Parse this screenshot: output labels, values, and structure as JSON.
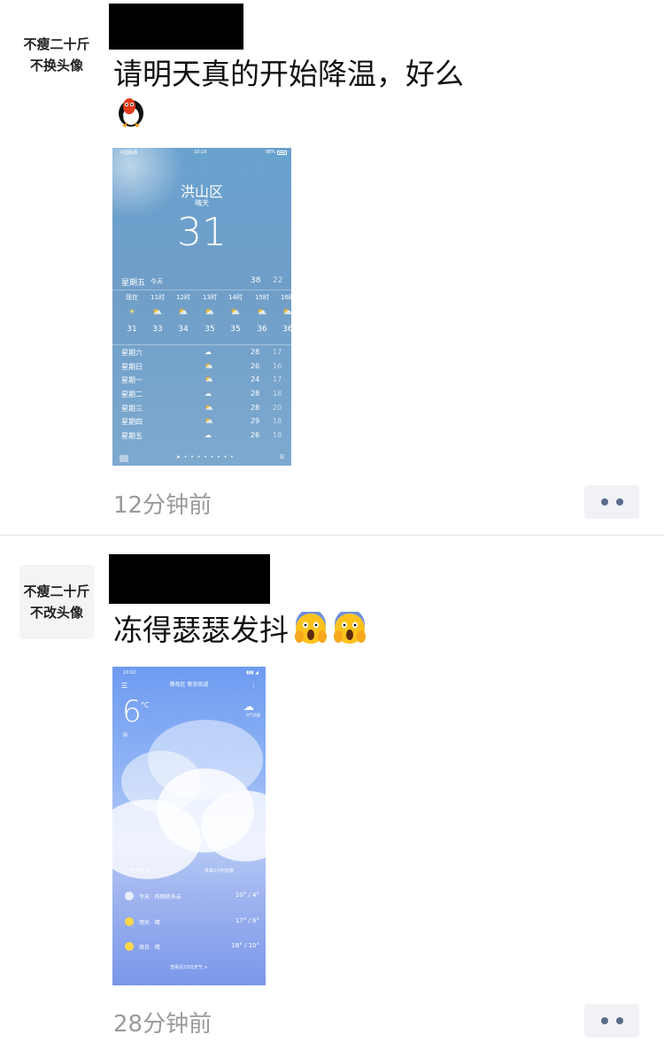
{
  "posts": [
    {
      "avatar": {
        "line1": "不瘦二十斤",
        "line2": "不换头像"
      },
      "text": "请明天真的开始降温，好么",
      "time": "12分钟前",
      "screenshot": {
        "status_time": "10:18",
        "status_left": "中国联通",
        "status_right": "98%",
        "city": "洪山区",
        "condition": "晴天",
        "temperature": "31",
        "today": {
          "day": "星期五",
          "label": "今天",
          "high": "38",
          "low": "22"
        },
        "hours": [
          {
            "time": "现在",
            "icon": "sun",
            "temp": "31"
          },
          {
            "time": "11时",
            "icon": "partly-cloudy",
            "temp": "33"
          },
          {
            "time": "12时",
            "icon": "partly-cloudy",
            "temp": "34"
          },
          {
            "time": "13时",
            "icon": "partly-cloudy",
            "temp": "35"
          },
          {
            "time": "14时",
            "icon": "partly-cloudy",
            "temp": "35"
          },
          {
            "time": "15时",
            "icon": "partly-cloudy",
            "temp": "36"
          },
          {
            "time": "16时",
            "icon": "partly-cloudy",
            "temp": "36"
          }
        ],
        "days": [
          {
            "name": "星期六",
            "icon": "cloud",
            "high": "28",
            "low": "17"
          },
          {
            "name": "星期日",
            "icon": "partly-cloudy",
            "high": "26",
            "low": "16"
          },
          {
            "name": "星期一",
            "icon": "partly-cloudy",
            "high": "24",
            "low": "17"
          },
          {
            "name": "星期二",
            "icon": "cloud",
            "high": "28",
            "low": "18"
          },
          {
            "name": "星期三",
            "icon": "partly-cloudy",
            "high": "28",
            "low": "20"
          },
          {
            "name": "星期四",
            "icon": "partly-cloudy",
            "high": "29",
            "low": "18"
          },
          {
            "name": "星期五",
            "icon": "cloud",
            "high": "26",
            "low": "18"
          }
        ]
      }
    },
    {
      "avatar": {
        "line1": "不瘦二十斤",
        "line2": "不改头像"
      },
      "text": "冻得瑟瑟发抖",
      "time": "28分钟前",
      "screenshot": {
        "status_time": "10:02",
        "title": "蔡甸区 新农街道",
        "temperature": "6",
        "unit": "°C",
        "condition": "阴",
        "badge_text": "空气质量",
        "air_quality": "空气优 39",
        "forecast_note": "未来2小时无雨",
        "forecast": [
          {
            "label": "今天 · 阵雨转多云",
            "value": "10° / 4°",
            "icon": "rain-cloud"
          },
          {
            "label": "明天 · 晴",
            "value": "17° / 6°",
            "icon": "sun"
          },
          {
            "label": "周日 · 晴",
            "value": "18° / 10°",
            "icon": "sun"
          }
        ],
        "bottom_link": "查看近15日天气 >"
      }
    }
  ],
  "colors": {
    "time_text": "#9a9a9a",
    "more_dots": "#5a6b8c",
    "divider": "#e3e3e3"
  }
}
